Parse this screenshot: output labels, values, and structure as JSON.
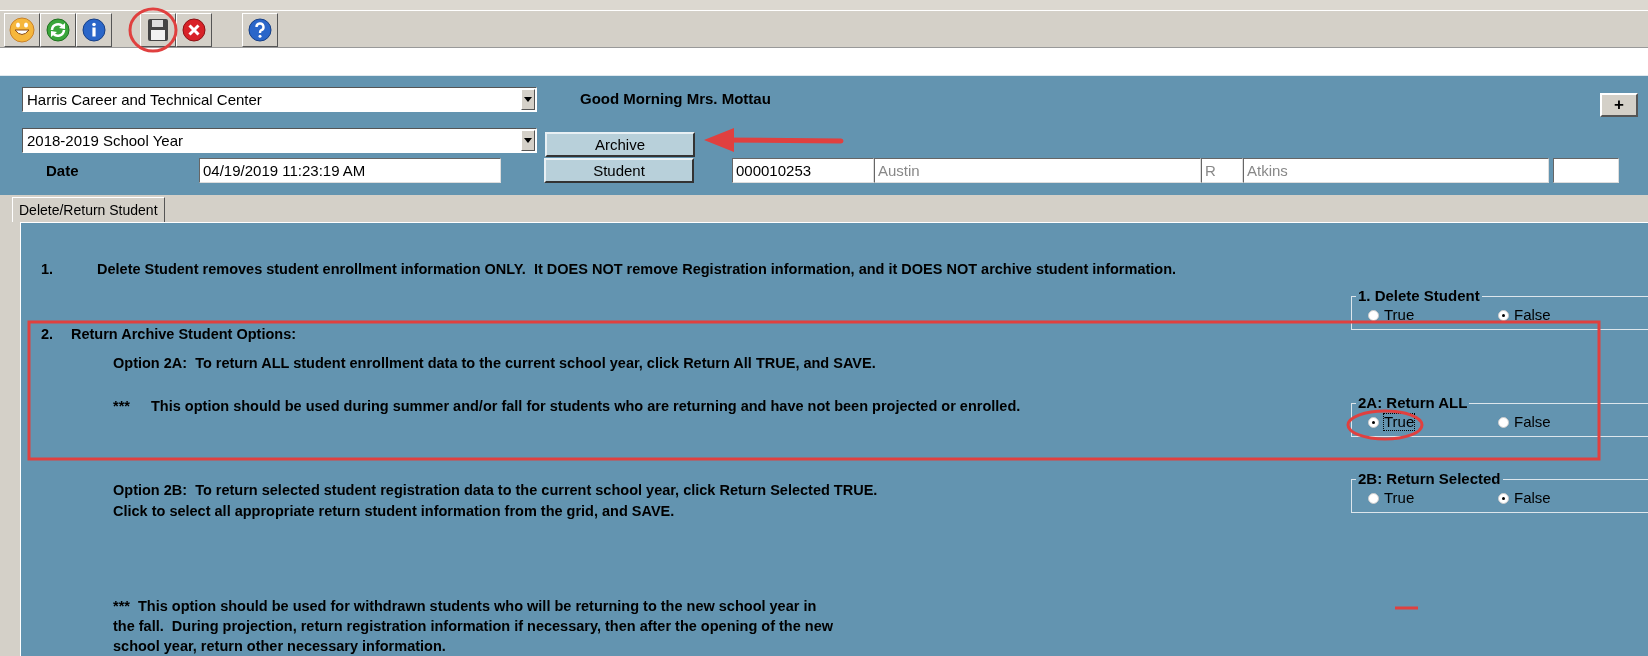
{
  "toolbar": {
    "buttons": [
      {
        "kind": "smiley"
      },
      {
        "kind": "refresh"
      },
      {
        "kind": "info"
      },
      {
        "kind": "save"
      },
      {
        "kind": "close"
      },
      {
        "kind": "help"
      }
    ]
  },
  "header": {
    "school_select": {
      "value": "Harris Career and Technical Center"
    },
    "year_select": {
      "value": "2018-2019 School Year"
    },
    "greeting": "Good Morning Mrs. Mottau",
    "plus_button": "+",
    "archive_button": "Archive",
    "date_label": "Date",
    "date_value": "04/19/2019 11:23:19 AM",
    "student_button": "Student",
    "student_id": "000010253",
    "first_name": "Austin",
    "middle_initial": "R",
    "last_name": "Atkins"
  },
  "tabs": [
    {
      "label": "Delete/Return Student",
      "selected": true
    }
  ],
  "instructions": [
    {
      "kind": "numbered",
      "number": "1.",
      "text": "Delete Student removes student enrollment information ONLY.  It DOES NOT remove Registration information, and it DOES NOT archive student information."
    },
    {
      "kind": "numbered",
      "number": "2.",
      "text": "Return Archive Student Options:"
    },
    {
      "kind": "paragraph",
      "text": "Option 2A:  To return ALL student enrollment data to the current school year, click Return All TRUE, and SAVE."
    },
    {
      "kind": "note",
      "number": "***",
      "text": "This option should be used during summer and/or fall for students who are returning and have not been projected or enrolled."
    },
    {
      "kind": "paragraph",
      "text": "Option 2B:  To return selected student registration data to the current school year, click Return Selected TRUE.  Click to select all appropriate return student information from the grid, and SAVE."
    },
    {
      "kind": "paragraph",
      "text": "***  This option should be used for withdrawn students who will be returning to the new school year in the fall.  During projection, return registration information if necessary, then after the opening of the new school year, return other necessary information."
    }
  ],
  "option_groups": [
    {
      "title": "1.  Delete Student",
      "options": [
        {
          "label": "True",
          "selected": false
        },
        {
          "label": "False",
          "selected": true
        }
      ]
    },
    {
      "title": "2A: Return ALL",
      "options": [
        {
          "label": "True",
          "selected": true
        },
        {
          "label": "False",
          "selected": false
        }
      ]
    },
    {
      "title": "2B: Return Selected",
      "options": [
        {
          "label": "True",
          "selected": false
        },
        {
          "label": "False",
          "selected": true
        }
      ]
    }
  ]
}
